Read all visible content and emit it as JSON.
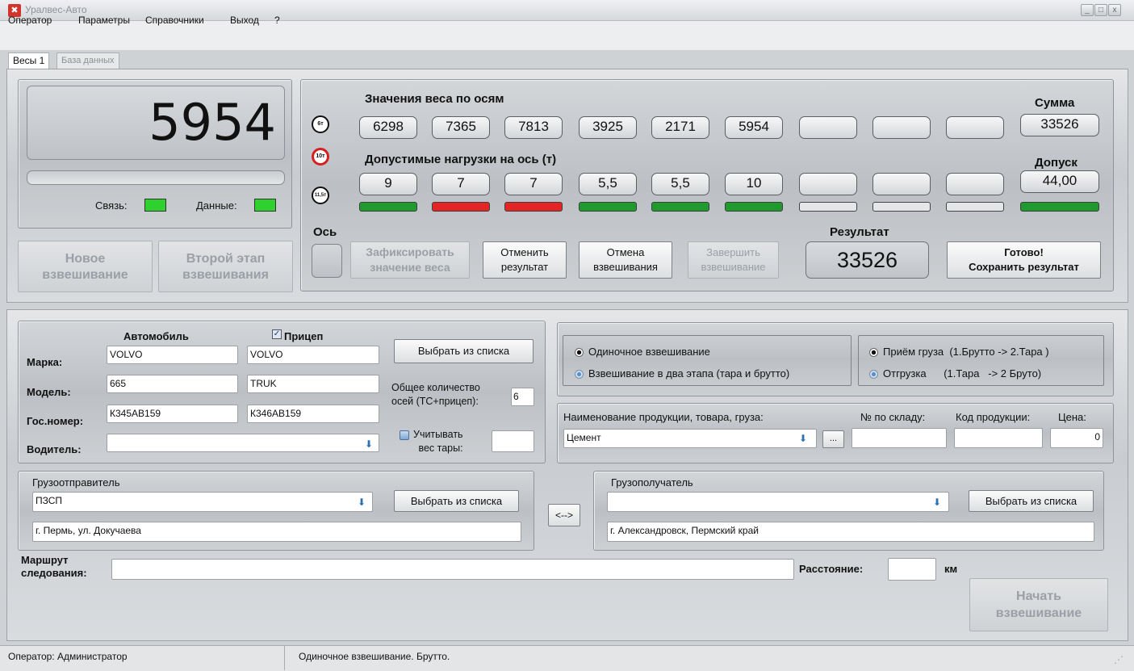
{
  "window": {
    "title": "Уралвес-Авто",
    "icon": "tools-icon",
    "controls": [
      "_",
      "□",
      "x"
    ]
  },
  "menu": [
    "Оператор",
    "Параметры",
    "Справочники",
    "Выход",
    "?"
  ],
  "tabs": [
    {
      "label": "Весы 1",
      "active": true
    },
    {
      "label": "База данных",
      "active": false
    }
  ],
  "scale": {
    "weight": "5954",
    "progress": 0,
    "link_label": "Связь:",
    "data_label": "Данные:",
    "status_color": "#2fd12f",
    "new_weighing_button": "Новое\nвзвешивание",
    "second_stage_button": "Второй этап\nвзвешивания"
  },
  "axles": {
    "weights_title": "Значения веса по осям",
    "sum_title": "Сумма",
    "weights": [
      "6298",
      "7365",
      "7813",
      "3925",
      "2171",
      "5954",
      "",
      "",
      ""
    ],
    "sum": "33526",
    "limits_title": "Допустимые нагрузки на ось (т)",
    "tolerance_title": "Допуск",
    "limits": [
      "9",
      "7",
      "7",
      "5,5",
      "5,5",
      "10",
      "",
      "",
      ""
    ],
    "tolerance": "44,00",
    "status": [
      "ok",
      "over",
      "over",
      "ok",
      "ok",
      "ok",
      "none",
      "none",
      "none"
    ],
    "total_status": "ok",
    "icons": {
      "6t": "6т",
      "10t": "10т",
      "11_5t": "11,5т"
    },
    "axis_label": "Ось",
    "result_label": "Результат",
    "result": "33526",
    "colors": {
      "ok": "#1f9a2c",
      "over": "#e52424",
      "none": "#e4e6e8"
    }
  },
  "actions": {
    "fix_weight": "Зафиксировать\nзначение веса",
    "cancel_result": "Отменить\nрезультат",
    "cancel_weighing": "Отмена\nвзвешивания",
    "finish_weighing": "Завершить\nвзвешивание",
    "save": "Готово!\nСохранить результат"
  },
  "vehicle": {
    "col_car": "Автомобиль",
    "col_trailer": "Прицеп",
    "trailer_checked": true,
    "brand_label": "Марка:",
    "model_label": "Модель:",
    "plate_label": "Гос.номер:",
    "driver_label": "Водитель:",
    "car_brand": "VOLVO",
    "trailer_brand": "VOLVO",
    "car_model": "665",
    "trailer_model": "TRUK",
    "car_plate": "К345АВ159",
    "trailer_plate": "К346АВ159",
    "driver": "",
    "choose_button": "Выбрать из списка",
    "axles_label": "Общее количество\nосей (ТС+прицеп):",
    "axles_count": "6",
    "tare_label": "Учитывать\nвес тары:",
    "tare_checked": false,
    "tare_value": ""
  },
  "mode": {
    "single": "Одиночное взвешивание",
    "two_stage": "Взвешивание в два этапа (тара и брутто)",
    "receive": "Приём груза  (1.Брутто -> 2.Тара )",
    "ship": "Отгрузка      (1.Тара   -> 2 Бруто)"
  },
  "product": {
    "name_label": "Наименование продукции, товара, груза:",
    "name": "Цемент",
    "browse": "...",
    "stock_label": "№ по складу:",
    "stock": "",
    "code_label": "Код продукции:",
    "code": "",
    "price_label": "Цена:",
    "price": "0"
  },
  "sender": {
    "title": "Грузоотправитель",
    "name": "ПЗСП",
    "address": "г. Пермь, ул. Докучаева",
    "choose_button": "Выбрать из списка"
  },
  "swap_button": "<-->",
  "receiver": {
    "title": "Грузополучатель",
    "name": "",
    "address": "г. Александровск, Пермский край",
    "choose_button": "Выбрать из списка"
  },
  "route": {
    "label": "Маршрут\nследования:",
    "value": "",
    "distance_label": "Расстояние:",
    "distance": "",
    "unit": "км"
  },
  "start_button": "Начать\nвзвешивание",
  "status": {
    "operator": "Оператор: Администратор",
    "mode": "Одиночное взвешивание. Брутто."
  }
}
